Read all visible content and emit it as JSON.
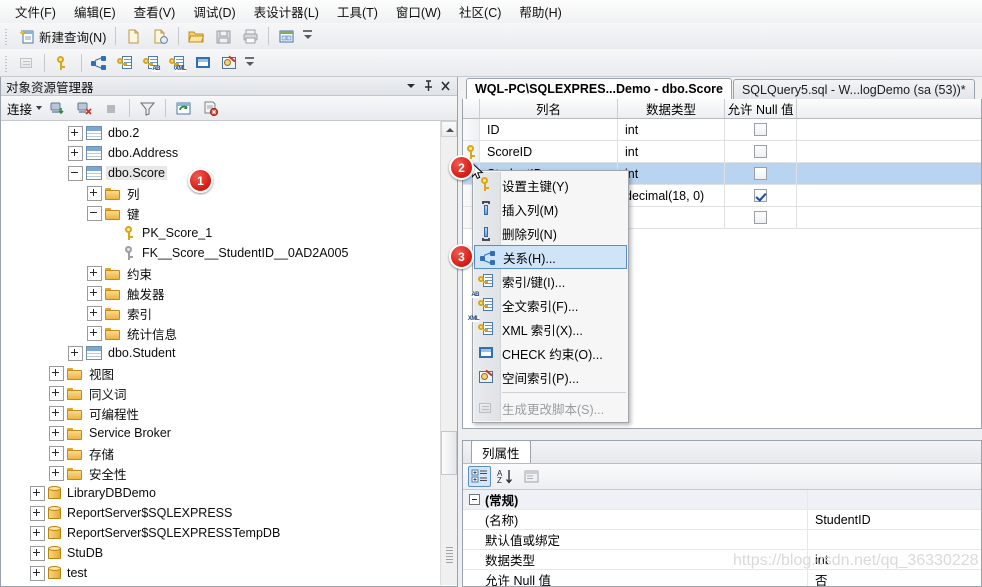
{
  "menubar": {
    "items": [
      {
        "label": "文件(F)",
        "name": "menu-file"
      },
      {
        "label": "编辑(E)",
        "name": "menu-edit"
      },
      {
        "label": "查看(V)",
        "name": "menu-view"
      },
      {
        "label": "调试(D)",
        "name": "menu-debug"
      },
      {
        "label": "表设计器(L)",
        "name": "menu-table-designer"
      },
      {
        "label": "工具(T)",
        "name": "menu-tools"
      },
      {
        "label": "窗口(W)",
        "name": "menu-window"
      },
      {
        "label": "社区(C)",
        "name": "menu-community"
      },
      {
        "label": "帮助(H)",
        "name": "menu-help"
      }
    ]
  },
  "toolbar_main": {
    "new_query_label": "新建查询(N)",
    "icons": [
      "new-query-icon",
      "new-file-icon",
      "new-file-script-icon",
      "open-folder-icon",
      "save-icon",
      "print-icon",
      "database-diagram-icon"
    ]
  },
  "toolbar_designer": {
    "icons": [
      "generate-change-script-icon",
      "set-primary-key-icon",
      "relationships-icon",
      "manage-indexes-keys-icon",
      "manage-fulltext-index-icon",
      "manage-xml-indexes-icon",
      "check-constraints-icon",
      "spatial-index-icon"
    ]
  },
  "object_explorer": {
    "title": "对象资源管理器",
    "connect_label": "连接",
    "toolbar_icons": [
      "connect-icon",
      "disconnect-icon",
      "stop-icon",
      "filter-icon",
      "refresh-icon",
      "script-report-icon"
    ],
    "title_buttons": [
      "chevron-down-icon",
      "pin-icon",
      "close-icon"
    ],
    "tree": [
      {
        "label": "dbo.2",
        "icon": "table-icon",
        "indent": 3,
        "state": "collapsed",
        "name": "tree-item-dbo-2"
      },
      {
        "label": "dbo.Address",
        "icon": "table-icon",
        "indent": 3,
        "state": "collapsed",
        "name": "tree-item-dbo-address"
      },
      {
        "label": "dbo.Score",
        "icon": "table-icon",
        "indent": 3,
        "state": "expanded",
        "selected": true,
        "name": "tree-item-dbo-score"
      },
      {
        "label": "列",
        "icon": "folder-icon",
        "indent": 4,
        "state": "collapsed",
        "name": "tree-item-columns"
      },
      {
        "label": "键",
        "icon": "folder-icon",
        "indent": 4,
        "state": "expanded",
        "name": "tree-item-keys"
      },
      {
        "label": "PK_Score_1",
        "icon": "key-gold-icon",
        "indent": 5,
        "state": "leaf",
        "name": "tree-item-pk-score-1"
      },
      {
        "label": "FK__Score__StudentID__0AD2A005",
        "icon": "key-gray-icon",
        "indent": 5,
        "state": "leaf",
        "name": "tree-item-fk-score-studentid"
      },
      {
        "label": "约束",
        "icon": "folder-icon",
        "indent": 4,
        "state": "collapsed",
        "name": "tree-item-constraints"
      },
      {
        "label": "触发器",
        "icon": "folder-icon",
        "indent": 4,
        "state": "collapsed",
        "name": "tree-item-triggers"
      },
      {
        "label": "索引",
        "icon": "folder-icon",
        "indent": 4,
        "state": "collapsed",
        "name": "tree-item-indexes"
      },
      {
        "label": "统计信息",
        "icon": "folder-icon",
        "indent": 4,
        "state": "collapsed",
        "name": "tree-item-statistics"
      },
      {
        "label": "dbo.Student",
        "icon": "table-icon",
        "indent": 3,
        "state": "collapsed",
        "name": "tree-item-dbo-student"
      },
      {
        "label": "视图",
        "icon": "folder-icon",
        "indent": 2,
        "state": "collapsed",
        "name": "tree-item-views"
      },
      {
        "label": "同义词",
        "icon": "folder-icon",
        "indent": 2,
        "state": "collapsed",
        "name": "tree-item-synonyms"
      },
      {
        "label": "可编程性",
        "icon": "folder-icon",
        "indent": 2,
        "state": "collapsed",
        "name": "tree-item-programmability"
      },
      {
        "label": "Service Broker",
        "icon": "folder-icon",
        "indent": 2,
        "state": "collapsed",
        "name": "tree-item-service-broker"
      },
      {
        "label": "存储",
        "icon": "folder-icon",
        "indent": 2,
        "state": "collapsed",
        "name": "tree-item-storage"
      },
      {
        "label": "安全性",
        "icon": "folder-icon",
        "indent": 2,
        "state": "collapsed",
        "name": "tree-item-security"
      },
      {
        "label": "LibraryDBDemo",
        "icon": "database-icon",
        "indent": 1,
        "state": "collapsed",
        "name": "tree-item-librarydbdemo"
      },
      {
        "label": "ReportServer$SQLEXPRESS",
        "icon": "database-icon",
        "indent": 1,
        "state": "collapsed",
        "name": "tree-item-reportserver"
      },
      {
        "label": "ReportServer$SQLEXPRESSTempDB",
        "icon": "database-icon",
        "indent": 1,
        "state": "collapsed",
        "name": "tree-item-reportserver-tempdb"
      },
      {
        "label": "StuDB",
        "icon": "database-icon",
        "indent": 1,
        "state": "collapsed",
        "name": "tree-item-studb"
      },
      {
        "label": "test",
        "icon": "database-icon",
        "indent": 1,
        "state": "collapsed",
        "name": "tree-item-test"
      }
    ]
  },
  "document_tabs": [
    {
      "label": "WQL-PC\\SQLEXPRES...Demo - dbo.Score",
      "active": true,
      "name": "tab-table-designer"
    },
    {
      "label": "SQLQuery5.sql - W...logDemo (sa (53))*",
      "active": false,
      "name": "tab-sqlquery5"
    }
  ],
  "designer_grid": {
    "headers": [
      "列名",
      "数据类型",
      "允许 Null 值"
    ],
    "rows": [
      {
        "key": "",
        "name": "ID",
        "type": "int",
        "allow_null": false,
        "selected": false
      },
      {
        "key": "primary",
        "name": "ScoreID",
        "type": "int",
        "allow_null": false,
        "selected": false
      },
      {
        "key": "",
        "name": "StudentID",
        "type": "int",
        "allow_null": false,
        "selected": true
      },
      {
        "key": "",
        "name": "",
        "type": "decimal(18, 0)",
        "allow_null": true,
        "selected": false
      },
      {
        "key": "",
        "name": "",
        "type": "",
        "allow_null": false,
        "selected": false
      }
    ]
  },
  "context_menu": {
    "items": [
      {
        "label": "设置主键(Y)",
        "icon": "primary-key-icon",
        "state": "normal",
        "name": "ctx-set-primary-key"
      },
      {
        "label": "插入列(M)",
        "icon": "insert-column-icon",
        "state": "normal",
        "name": "ctx-insert-column"
      },
      {
        "label": "删除列(N)",
        "icon": "delete-column-icon",
        "state": "normal",
        "name": "ctx-delete-column"
      },
      {
        "label": "关系(H)...",
        "icon": "relationships-icon",
        "state": "highlighted",
        "name": "ctx-relationships"
      },
      {
        "label": "索引/键(I)...",
        "icon": "indexes-keys-icon",
        "state": "normal",
        "name": "ctx-indexes-keys"
      },
      {
        "label": "全文索引(F)...",
        "icon": "fulltext-index-icon",
        "state": "normal",
        "name": "ctx-fulltext-index"
      },
      {
        "label": "XML 索引(X)...",
        "icon": "xml-index-icon",
        "state": "normal",
        "name": "ctx-xml-index"
      },
      {
        "label": "CHECK 约束(O)...",
        "icon": "check-constraints-icon",
        "state": "normal",
        "name": "ctx-check-constraints"
      },
      {
        "label": "空间索引(P)...",
        "icon": "spatial-index-icon",
        "state": "normal",
        "name": "ctx-spatial-index"
      },
      {
        "label": "生成更改脚本(S)...",
        "icon": "generate-change-script-icon",
        "state": "disabled",
        "name": "ctx-generate-change-script"
      }
    ]
  },
  "column_properties": {
    "tab_label": "列属性",
    "toolbar_icons": [
      "categorized-icon",
      "alphabetical-icon",
      "property-pages-icon"
    ],
    "rows": [
      {
        "label": "(常规)",
        "value": "",
        "category": true,
        "name": "prop-category-general"
      },
      {
        "label": "(名称)",
        "value": "StudentID",
        "category": false,
        "name": "prop-name"
      },
      {
        "label": "默认值或绑定",
        "value": "",
        "category": false,
        "name": "prop-default-value"
      },
      {
        "label": "数据类型",
        "value": "int",
        "category": false,
        "name": "prop-data-type"
      },
      {
        "label": "允许 Null 值",
        "value": "否",
        "category": false,
        "name": "prop-allow-nulls"
      }
    ]
  },
  "step_badges": [
    {
      "number": "1",
      "name": "step-badge-1"
    },
    {
      "number": "2",
      "name": "step-badge-2"
    },
    {
      "number": "3",
      "name": "step-badge-3"
    }
  ],
  "watermark": "https://blog.csdn.net/qq_36330228"
}
